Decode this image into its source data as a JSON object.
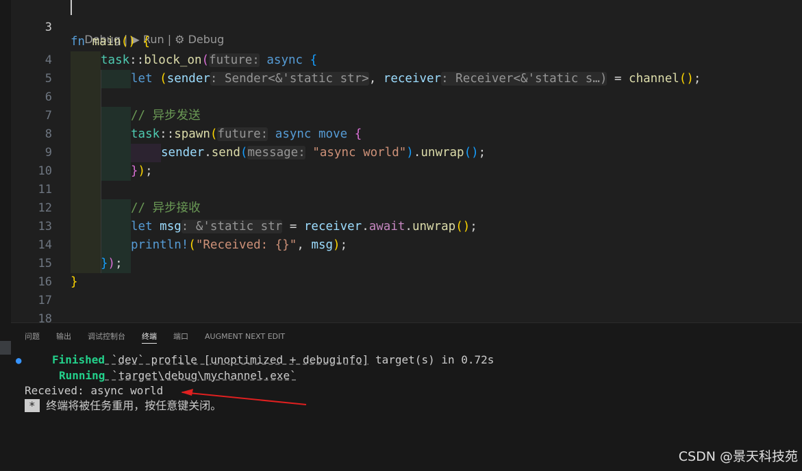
{
  "editor": {
    "codelens": {
      "debug": "Debug",
      "sep": " | ",
      "run_icon": "▶",
      "run": " Run",
      "debug_icon": "⚙",
      "debug2": " Debug"
    },
    "line_numbers": [
      "3",
      "4",
      "5",
      "6",
      "7",
      "8",
      "9",
      "10",
      "11",
      "12",
      "13",
      "14",
      "15",
      "16",
      "17",
      "18"
    ],
    "tokens": {
      "fn": "fn",
      "main": "main",
      "task": "task",
      "colons": "::",
      "block_on": "block_on",
      "hint_future": "future:",
      "async": "async",
      "let": "let",
      "sender": "sender",
      "hint_sender_type": ": Sender<&'static str>",
      "receiver": "receiver",
      "hint_receiver_type": ": Receiver<&'static s…)",
      "channel": "channel",
      "comment_send": "// 异步发送",
      "spawn": "spawn",
      "move": "move",
      "send": "send",
      "hint_message": "message:",
      "str_async_world": "\"async world\"",
      "unwrap": "unwrap",
      "comment_recv": "// 异步接收",
      "msg": "msg",
      "hint_msg_type": ": &'static str",
      "await": "await",
      "println": "println!",
      "str_received": "\"Received: {}\""
    }
  },
  "panel": {
    "tabs": [
      {
        "label": "问题"
      },
      {
        "label": "输出"
      },
      {
        "label": "调试控制台"
      },
      {
        "label": "终端"
      },
      {
        "label": "端口"
      },
      {
        "label": "AUGMENT NEXT EDIT"
      }
    ],
    "terminal": {
      "finished_word": "Finished",
      "finished_rest_1": " `dev` profile [unoptimized + debuginfo]",
      "finished_rest_2": " target(s) in 0.72s",
      "running_word": "Running",
      "running_rest": " `target\\debug\\mychannel.exe`",
      "output": "Received: async world",
      "star": "*",
      "reuse_msg": " 终端将被任务重用，按任意键关闭。"
    }
  },
  "watermark": "CSDN @景天科技苑",
  "colors": {
    "accent_arrow": "#e02020",
    "terminal_dot": "#3794ff"
  }
}
